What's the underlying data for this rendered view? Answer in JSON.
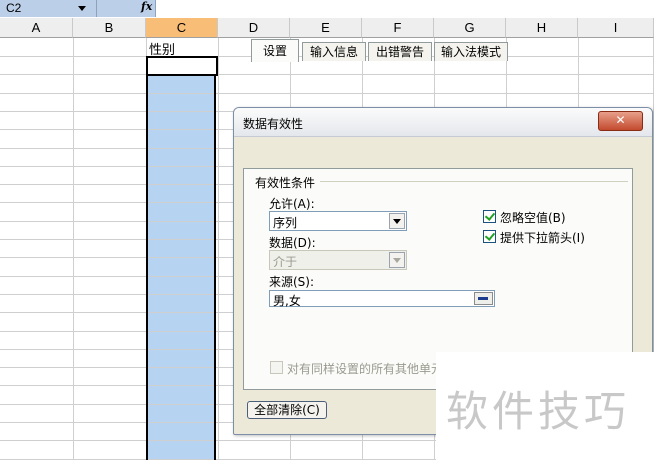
{
  "formula_bar": {
    "name_box": "C2",
    "fx_icon": "fx"
  },
  "sheet": {
    "columns": [
      "A",
      "B",
      "C",
      "D",
      "E",
      "F",
      "G",
      "H",
      "I"
    ],
    "selected_column": "C",
    "cells": {
      "C1": "性别"
    }
  },
  "dialog": {
    "title": "数据有效性",
    "close_label": "✕",
    "tabs": [
      "设置",
      "输入信息",
      "出错警告",
      "输入法模式"
    ],
    "active_tab": "设置",
    "group_label": "有效性条件",
    "allow_label": "允许(A):",
    "allow_value": "序列",
    "data_label": "数据(D):",
    "data_value": "介于",
    "source_label": "来源(S):",
    "source_value": "男,女",
    "ignore_blank_label": "忽略空值(B)",
    "ignore_blank_checked": true,
    "dropdown_label": "提供下拉箭头(I)",
    "dropdown_checked": true,
    "apply_all_label": "对有同样设置的所有其他单元",
    "clear_all_label": "全部清除(C)"
  },
  "watermark": "软件技巧"
}
